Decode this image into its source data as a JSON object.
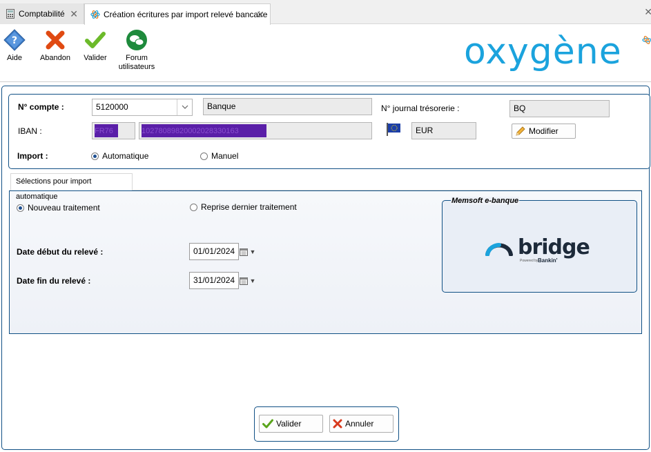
{
  "tabs": [
    {
      "label": "Comptabilité",
      "icon": "calculator-icon"
    },
    {
      "label": "Création écritures par import relevé bancaire",
      "icon": "oxygene-atom-icon"
    }
  ],
  "toolbar": {
    "aide": "Aide",
    "abandon": "Abandon",
    "valider": "Valider",
    "forum_line1": "Forum",
    "forum_line2": "utilisateurs"
  },
  "logo": "oxygène",
  "account": {
    "compte_label": "N° compte :",
    "compte_value": "5120000",
    "compte_name": "Banque",
    "journal_label": "N° journal trésorerie :",
    "journal_value": "BQ",
    "iban_label": "IBAN :",
    "iban_prefix": "FR76",
    "iban_rest": "10278089820002028330163",
    "currency": "EUR",
    "modifier_label": "Modifier",
    "import_label": "Import :",
    "import_options": [
      "Automatique",
      "Manuel"
    ],
    "import_selected": "Automatique"
  },
  "section": {
    "tab_label": "Sélections pour import automatique",
    "treatment_options": [
      "Nouveau traitement",
      "Reprise dernier traitement"
    ],
    "treatment_selected": "Nouveau traitement",
    "date_debut_label": "Date début du relevé :",
    "date_debut_value": "01/01/2024",
    "date_fin_label": "Date fin du relevé :",
    "date_fin_value": "31/01/2024",
    "memsoft_title": "Memsoft e-banque",
    "bridge_word": "bridge",
    "bridge_sub": "Powered by",
    "bridge_brand": "Bankin'"
  },
  "footer": {
    "valider": "Valider",
    "annuler": "Annuler"
  },
  "colors": {
    "accent": "#0f4f84",
    "logo": "#1ba3dd",
    "redaction": "#5a1fa8"
  }
}
